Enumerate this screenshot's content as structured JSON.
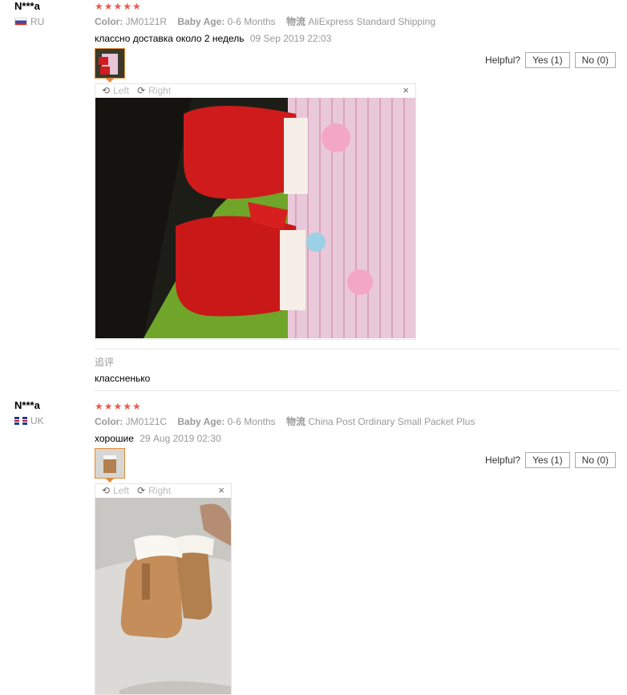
{
  "reviews": [
    {
      "user": "N***a",
      "country": "RU",
      "flag": "russia-flag",
      "stars": "★★★★★",
      "color_label": "Color:",
      "color_value": "JM0121R",
      "age_label": "Baby Age:",
      "age_value": "0-6 Months",
      "shipping_label": "物流",
      "shipping_value": "AliExpress Standard Shipping",
      "feedback": "классно доставка около 2 недель",
      "date": "09 Sep 2019 22:03",
      "viewer": {
        "left": "Left",
        "right": "Right",
        "close": "×"
      },
      "helpful_label": "Helpful?",
      "yes_label": "Yes (1)",
      "no_label": "No (0)",
      "additional_label": "追评",
      "additional_text": "классненько"
    },
    {
      "user": "N***a",
      "country": "UK",
      "flag": "uk-flag",
      "stars": "★★★★★",
      "color_label": "Color:",
      "color_value": "JM0121C",
      "age_label": "Baby Age:",
      "age_value": "0-6 Months",
      "shipping_label": "物流",
      "shipping_value": "China Post Ordinary Small Packet Plus",
      "feedback": "хорошие",
      "date": "29 Aug 2019 02:30",
      "viewer": {
        "left": "Left",
        "right": "Right",
        "close": "×"
      },
      "helpful_label": "Helpful?",
      "yes_label": "Yes (1)",
      "no_label": "No (0)"
    }
  ],
  "colors": {
    "star": "#e85a4f",
    "thumb_border": "#e08a3a"
  }
}
